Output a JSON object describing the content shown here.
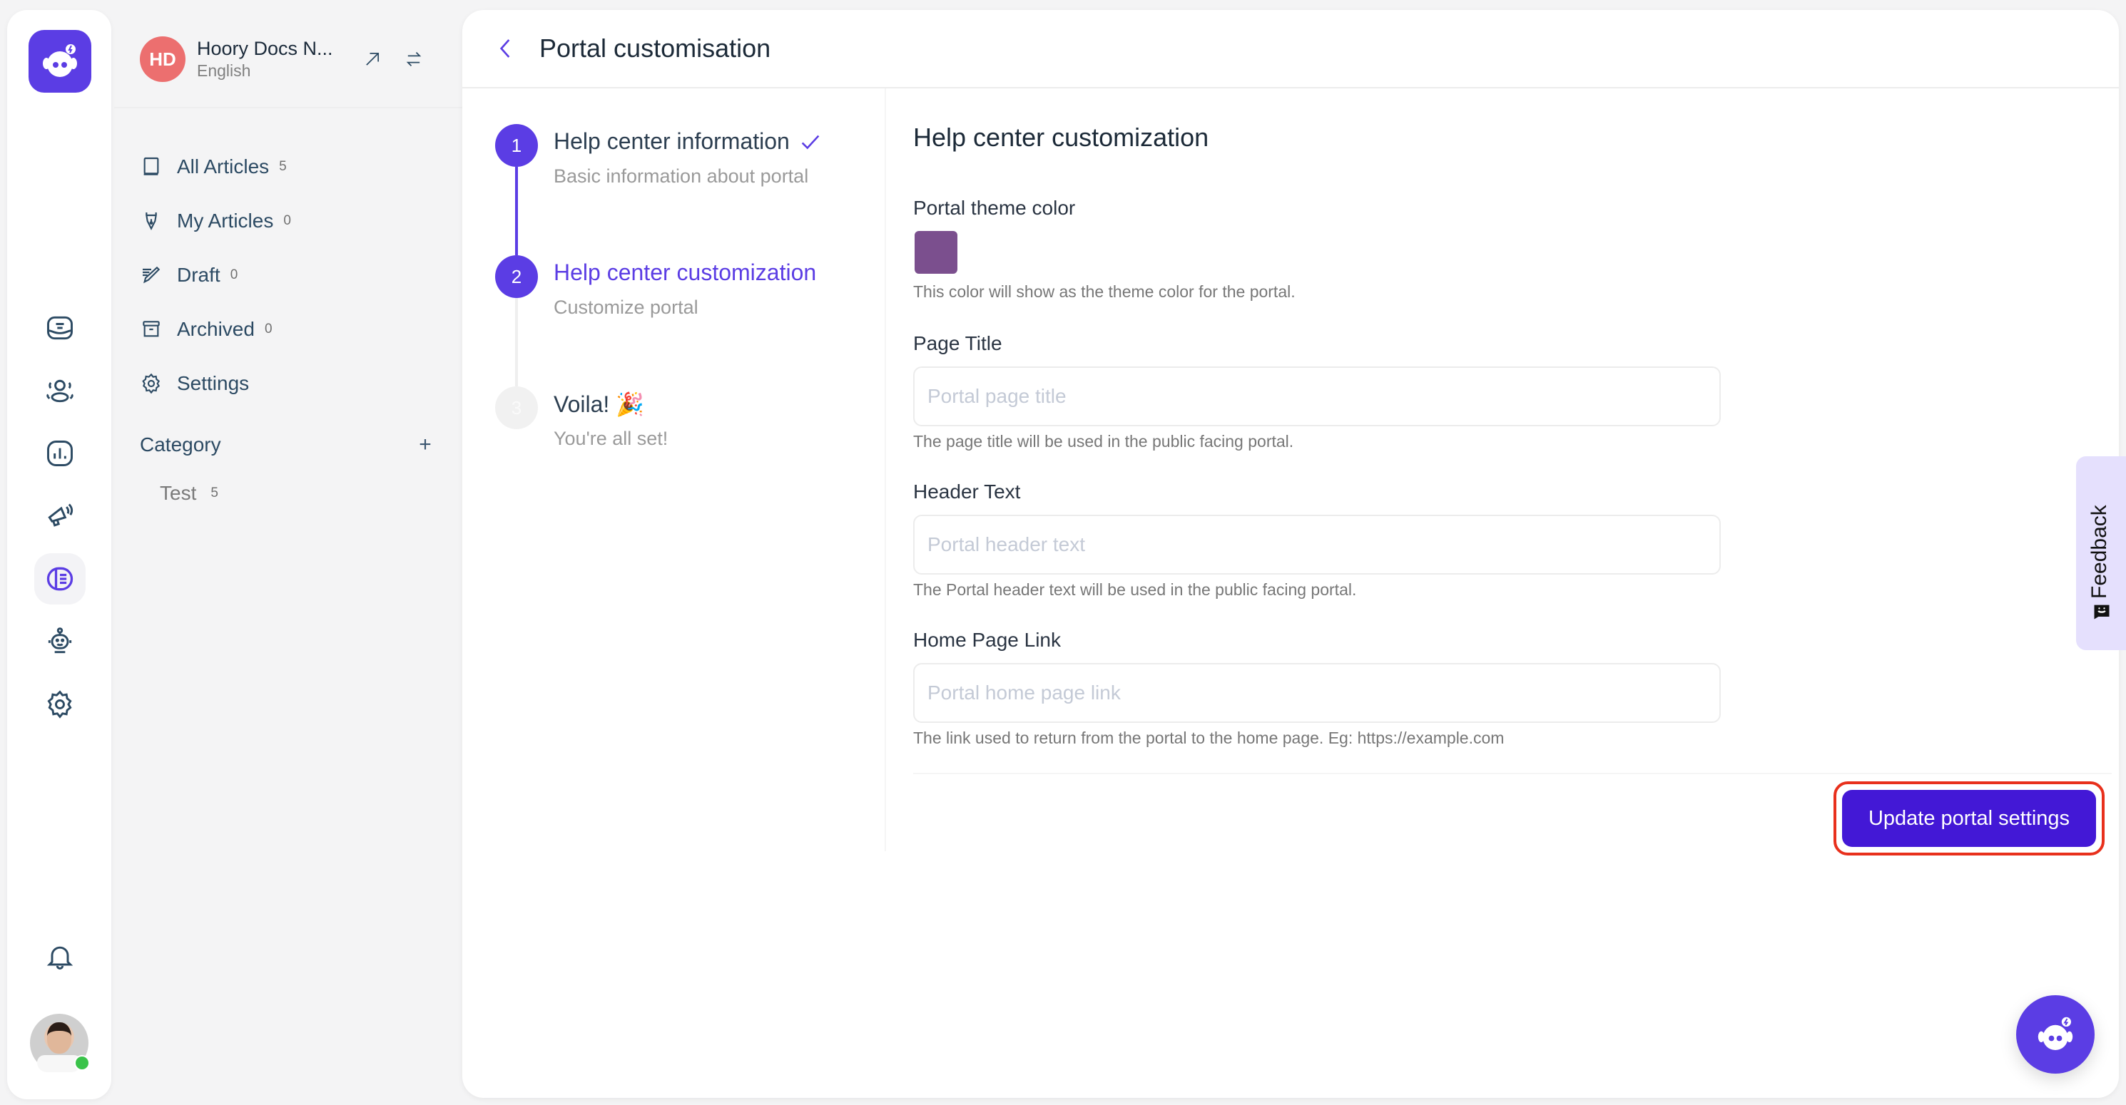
{
  "rail": {
    "logo_icon": "hoory-bot-logo",
    "items": [
      {
        "icon": "inbox-icon",
        "active": false
      },
      {
        "icon": "contacts-icon",
        "active": false
      },
      {
        "icon": "reports-icon",
        "active": false
      },
      {
        "icon": "campaigns-icon",
        "active": false
      },
      {
        "icon": "help-center-icon",
        "active": true
      },
      {
        "icon": "bot-icon",
        "active": false
      },
      {
        "icon": "settings-icon",
        "active": false
      }
    ],
    "notifications_icon": "bell-icon",
    "user_status": "online"
  },
  "sidebar": {
    "portal": {
      "initials": "HD",
      "name": "Hoory Docs N...",
      "locale": "English"
    },
    "nav": [
      {
        "label": "All Articles",
        "count": "5",
        "icon": "book-icon"
      },
      {
        "label": "My Articles",
        "count": "0",
        "icon": "pen-nib-icon"
      },
      {
        "label": "Draft",
        "count": "0",
        "icon": "draft-pencil-icon"
      },
      {
        "label": "Archived",
        "count": "0",
        "icon": "archive-box-icon"
      },
      {
        "label": "Settings",
        "count": null,
        "icon": "gear-icon"
      }
    ],
    "category": {
      "title": "Category",
      "add_label": "+",
      "items": [
        {
          "label": "Test",
          "count": "5"
        }
      ]
    }
  },
  "main": {
    "title": "Portal customisation",
    "steps": [
      {
        "number": "1",
        "title": "Help center information",
        "subtitle": "Basic information about portal",
        "state": "done"
      },
      {
        "number": "2",
        "title": "Help center customization",
        "subtitle": "Customize portal",
        "state": "current"
      },
      {
        "number": "3",
        "title": "Voila! 🎉",
        "subtitle": "You're all set!",
        "state": "pending"
      }
    ],
    "form": {
      "title": "Help center customization",
      "theme_color": {
        "label": "Portal theme color",
        "value": "#7b4f8e",
        "help": "This color will show as the theme color for the portal."
      },
      "page_title": {
        "label": "Page Title",
        "value": "",
        "placeholder": "Portal page title",
        "help": "The page title will be used in the public facing portal."
      },
      "header_text": {
        "label": "Header Text",
        "value": "",
        "placeholder": "Portal header text",
        "help": "The Portal header text will be used in the public facing portal."
      },
      "home_page_link": {
        "label": "Home Page Link",
        "value": "",
        "placeholder": "Portal home page link",
        "help": "The link used to return from the portal to the home page. Eg: https://example.com"
      },
      "submit_label": "Update portal settings"
    }
  },
  "feedback": {
    "label": "Feedback"
  },
  "colors": {
    "accent": "#5b3de4",
    "button": "#4318d6",
    "highlight_ring": "#e8301c",
    "portal_avatar": "#ec6f6f",
    "feedback_bg": "#e5e0fd"
  }
}
